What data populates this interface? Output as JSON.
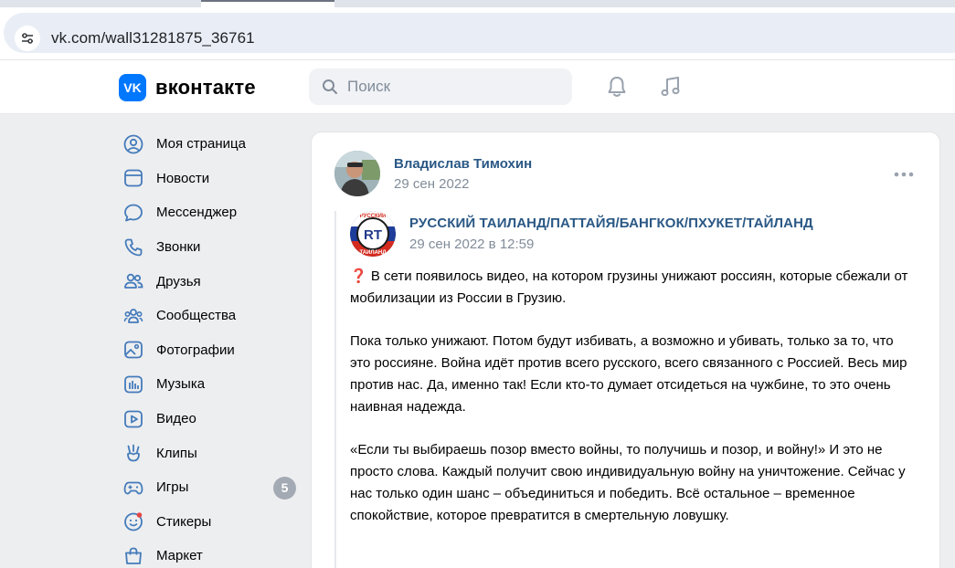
{
  "browser": {
    "url": "vk.com/wall31281875_36761"
  },
  "header": {
    "logo_mark": "VK",
    "logo_text": "вконтакте",
    "search_placeholder": "Поиск"
  },
  "sidebar": {
    "items": [
      {
        "label": "Моя страница",
        "icon": "user-circle-icon"
      },
      {
        "label": "Новости",
        "icon": "newspaper-icon"
      },
      {
        "label": "Мессенджер",
        "icon": "message-icon"
      },
      {
        "label": "Звонки",
        "icon": "phone-icon"
      },
      {
        "label": "Друзья",
        "icon": "friends-icon"
      },
      {
        "label": "Сообщества",
        "icon": "communities-icon"
      },
      {
        "label": "Фотографии",
        "icon": "photo-icon"
      },
      {
        "label": "Музыка",
        "icon": "music-icon"
      },
      {
        "label": "Видео",
        "icon": "video-icon"
      },
      {
        "label": "Клипы",
        "icon": "clips-icon"
      },
      {
        "label": "Игры",
        "icon": "gamepad-icon",
        "badge": "5"
      },
      {
        "label": "Стикеры",
        "icon": "sticker-icon"
      },
      {
        "label": "Маркет",
        "icon": "market-bag-icon"
      }
    ]
  },
  "post": {
    "author": "Владислав Тимохин",
    "date": "29 сен 2022",
    "repost": {
      "group_name": "РУССКИЙ ТАИЛАНД/ПАТТАЙЯ/БАНГКОК/ПХУКЕТ/ТАЙЛАНД",
      "avatar_letters": "RT",
      "avatar_top_text": "РУССКИЙ",
      "avatar_bottom_text": "ТАИЛАНД",
      "date": "29 сен 2022 в 12:59",
      "paragraphs": [
        "❓ В сети появилось видео, на котором грузины унижают россиян, которые сбежали от мобилизации из России в Грузию.",
        "Пока только унижают. Потом будут избивать, а возможно и убивать, только за то, что это россияне. Война идёт против всего русского, всего связанного с Россией. Весь мир против нас. Да, именно так! Если кто-то думает отсидеться на чужбине, то это очень наивная надежда.",
        "«Если ты выбираешь позор вместо войны, то получишь и позор, и войну!» И это не просто слова. Каждый получит свою индивидуальную войну на уничтожение. Сейчас у нас только один шанс – объединиться и победить. Всё остальное – временное спокойствие, которое превратится в смертельную ловушку."
      ]
    }
  },
  "colors": {
    "accent": "#0077ff",
    "link": "#2a5885",
    "muted": "#818c99",
    "icon": "#447bba"
  }
}
